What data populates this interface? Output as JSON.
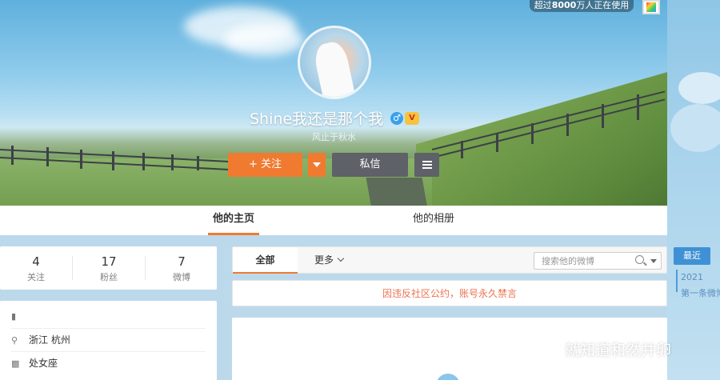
{
  "header": {
    "users_badge_prefix": "超过",
    "users_badge_count": "8000",
    "users_badge_suffix": "万人正在使用"
  },
  "profile": {
    "name": "Shine我还是那个我",
    "bio": "风止于秋水",
    "gender_symbol": "♂",
    "vip_symbol": "V"
  },
  "actions": {
    "follow_label": "+ 关注",
    "message_label": "私信"
  },
  "tabs": {
    "home": "他的主页",
    "album": "他的相册"
  },
  "stats": [
    {
      "value": "4",
      "label": "关注"
    },
    {
      "value": "17",
      "label": "粉丝"
    },
    {
      "value": "7",
      "label": "微博"
    }
  ],
  "info": {
    "location": "浙江 杭州",
    "zodiac": "处女座"
  },
  "feed": {
    "filter_all": "全部",
    "filter_more": "更多",
    "search_placeholder": "搜索他的微博",
    "notice": "因违反社区公约，账号永久禁言"
  },
  "timeline": {
    "latest": "最近",
    "year": "2021",
    "first_post": "第一条微博"
  },
  "watermark": "就知道和然并卵",
  "colors": {
    "accent": "#f07a30",
    "dark_button": "#5e6168",
    "notice_text": "#eb7350",
    "timeline_blue": "#3f91d5"
  }
}
